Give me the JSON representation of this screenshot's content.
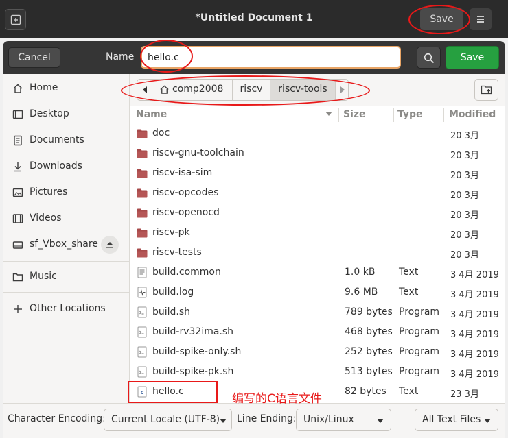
{
  "window": {
    "title": "*Untitled Document 1",
    "save_label": "Save"
  },
  "dialog": {
    "cancel_label": "Cancel",
    "name_label": "Name",
    "name_value": "hello.c",
    "save_label": "Save"
  },
  "sidebar": {
    "items": [
      {
        "label": "Home",
        "icon": "home-icon"
      },
      {
        "label": "Desktop",
        "icon": "desktop-icon"
      },
      {
        "label": "Documents",
        "icon": "documents-icon"
      },
      {
        "label": "Downloads",
        "icon": "downloads-icon"
      },
      {
        "label": "Pictures",
        "icon": "pictures-icon"
      },
      {
        "label": "Videos",
        "icon": "videos-icon"
      },
      {
        "label": "sf_Vbox_share",
        "icon": "drive-icon"
      },
      {
        "label": "Music",
        "icon": "folder-icon"
      },
      {
        "label": "Other Locations",
        "icon": "plus-icon"
      }
    ]
  },
  "pathbar": {
    "segments": [
      "comp2008",
      "riscv",
      "riscv-tools"
    ],
    "active": "riscv-tools"
  },
  "columns": {
    "name": "Name",
    "size": "Size",
    "type": "Type",
    "modified": "Modified"
  },
  "files": [
    {
      "name": "doc",
      "size": "",
      "type": "",
      "modified": "20 3月",
      "kind": "folder"
    },
    {
      "name": "riscv-gnu-toolchain",
      "size": "",
      "type": "",
      "modified": "20 3月",
      "kind": "folder"
    },
    {
      "name": "riscv-isa-sim",
      "size": "",
      "type": "",
      "modified": "20 3月",
      "kind": "folder"
    },
    {
      "name": "riscv-opcodes",
      "size": "",
      "type": "",
      "modified": "20 3月",
      "kind": "folder"
    },
    {
      "name": "riscv-openocd",
      "size": "",
      "type": "",
      "modified": "20 3月",
      "kind": "folder"
    },
    {
      "name": "riscv-pk",
      "size": "",
      "type": "",
      "modified": "20 3月",
      "kind": "folder"
    },
    {
      "name": "riscv-tests",
      "size": "",
      "type": "",
      "modified": "20 3月",
      "kind": "folder"
    },
    {
      "name": "build.common",
      "size": "1.0 kB",
      "type": "Text",
      "modified": "3 4月 2019",
      "kind": "text"
    },
    {
      "name": "build.log",
      "size": "9.6 MB",
      "type": "Text",
      "modified": "3 4月 2019",
      "kind": "log"
    },
    {
      "name": "build.sh",
      "size": "789 bytes",
      "type": "Program",
      "modified": "3 4月 2019",
      "kind": "script"
    },
    {
      "name": "build-rv32ima.sh",
      "size": "468 bytes",
      "type": "Program",
      "modified": "3 4月 2019",
      "kind": "script"
    },
    {
      "name": "build-spike-only.sh",
      "size": "252 bytes",
      "type": "Program",
      "modified": "3 4月 2019",
      "kind": "script"
    },
    {
      "name": "build-spike-pk.sh",
      "size": "513 bytes",
      "type": "Program",
      "modified": "3 4月 2019",
      "kind": "script"
    },
    {
      "name": "hello.c",
      "size": "82 bytes",
      "type": "Text",
      "modified": "23 3月",
      "kind": "c-source"
    }
  ],
  "footer": {
    "encoding_label": "Character Encoding:",
    "encoding_value": "Current Locale (UTF-8)",
    "line_ending_label": "Line Ending:",
    "line_ending_value": "Unix/Linux",
    "filter_value": "All Text Files"
  },
  "annotation": {
    "text": "编写的C语言文件",
    "color": "#e81919"
  }
}
